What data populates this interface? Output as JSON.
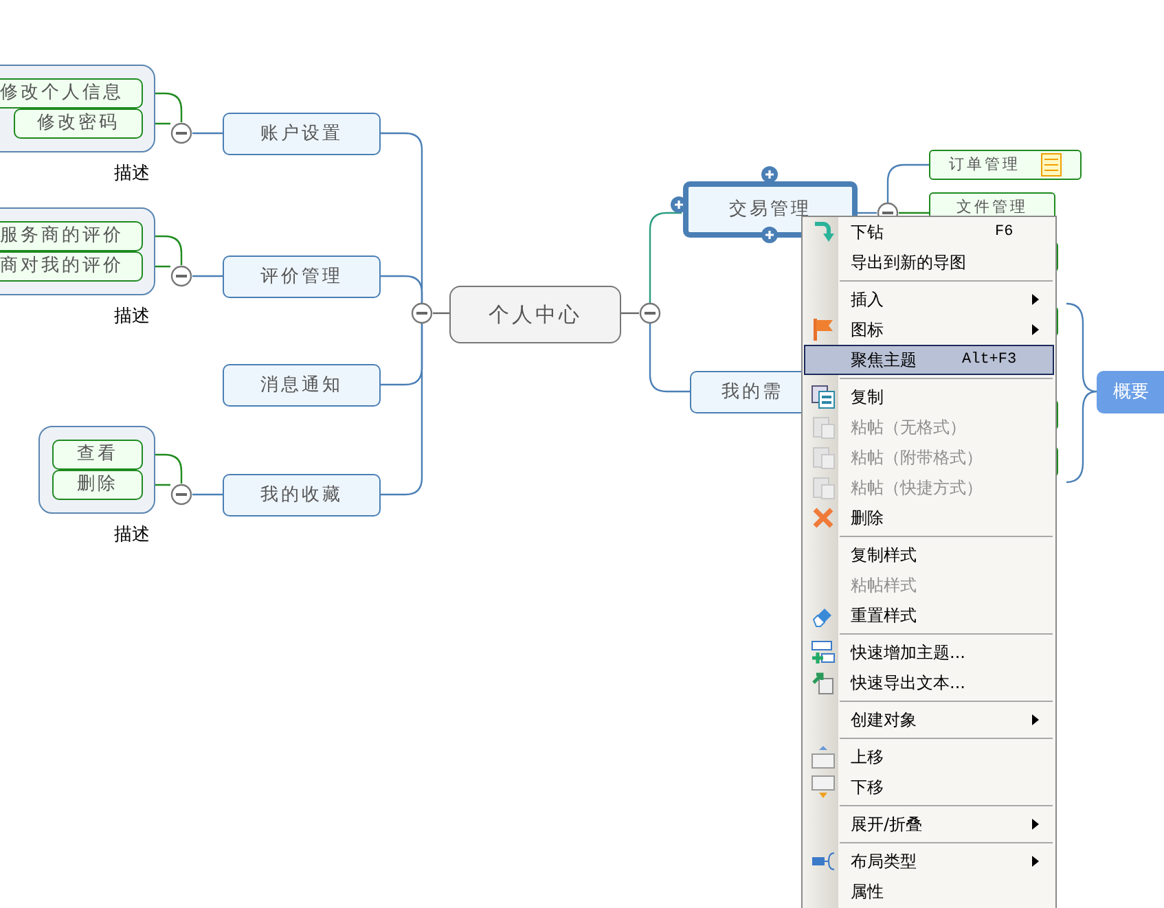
{
  "mindmap": {
    "central": {
      "label": "个人中心"
    },
    "left_topics": [
      {
        "label": "账户设置",
        "boundary": {
          "label": "描述",
          "children": [
            {
              "label": "修改个人信息"
            },
            {
              "label": "修改密码"
            }
          ]
        }
      },
      {
        "label": "评价管理",
        "boundary": {
          "label": "描述",
          "children": [
            {
              "label": "服务商的评价"
            },
            {
              "label": "商对我的评价"
            }
          ]
        }
      },
      {
        "label": "消息通知"
      },
      {
        "label": "我的收藏",
        "boundary": {
          "label": "描述",
          "children": [
            {
              "label": "查看"
            },
            {
              "label": "删除"
            }
          ]
        }
      }
    ],
    "right_topics": [
      {
        "label": "交易管理",
        "selected": true,
        "children": [
          {
            "label": "订单管理",
            "note": true
          },
          {
            "label": "文件管理",
            "note": false
          }
        ]
      },
      {
        "label": "我的需",
        "selected": false
      }
    ],
    "summary": {
      "label": "概要"
    }
  },
  "context_menu": [
    {
      "kind": "item",
      "label": "下钻",
      "shortcut": "F6",
      "disabled": false,
      "submenu": false,
      "selected": false
    },
    {
      "kind": "item",
      "label": "导出到新的导图",
      "disabled": false,
      "submenu": false,
      "selected": false
    },
    {
      "kind": "separator"
    },
    {
      "kind": "item",
      "label": "插入",
      "disabled": false,
      "submenu": true,
      "selected": false
    },
    {
      "kind": "item",
      "label": "图标",
      "disabled": false,
      "submenu": true,
      "selected": false
    },
    {
      "kind": "item",
      "label": "聚焦主题",
      "shortcut": "Alt+F3",
      "disabled": false,
      "submenu": false,
      "selected": true
    },
    {
      "kind": "separator"
    },
    {
      "kind": "item",
      "label": "复制",
      "disabled": false,
      "submenu": false,
      "selected": false
    },
    {
      "kind": "item",
      "label": "粘帖（无格式）",
      "disabled": true,
      "submenu": false,
      "selected": false
    },
    {
      "kind": "item",
      "label": "粘帖（附带格式）",
      "disabled": true,
      "submenu": false,
      "selected": false
    },
    {
      "kind": "item",
      "label": "粘帖（快捷方式）",
      "disabled": true,
      "submenu": false,
      "selected": false
    },
    {
      "kind": "item",
      "label": "删除",
      "disabled": false,
      "submenu": false,
      "selected": false
    },
    {
      "kind": "separator"
    },
    {
      "kind": "item",
      "label": "复制样式",
      "disabled": false,
      "submenu": false,
      "selected": false
    },
    {
      "kind": "item",
      "label": "粘帖样式",
      "disabled": true,
      "submenu": false,
      "selected": false
    },
    {
      "kind": "item",
      "label": "重置样式",
      "disabled": false,
      "submenu": false,
      "selected": false
    },
    {
      "kind": "separator"
    },
    {
      "kind": "item",
      "label": "快速增加主题...",
      "disabled": false,
      "submenu": false,
      "selected": false
    },
    {
      "kind": "item",
      "label": "快速导出文本...",
      "disabled": false,
      "submenu": false,
      "selected": false
    },
    {
      "kind": "separator"
    },
    {
      "kind": "item",
      "label": "创建对象",
      "disabled": false,
      "submenu": true,
      "selected": false
    },
    {
      "kind": "separator"
    },
    {
      "kind": "item",
      "label": "上移",
      "disabled": false,
      "submenu": false,
      "selected": false
    },
    {
      "kind": "item",
      "label": "下移",
      "disabled": false,
      "submenu": false,
      "selected": false
    },
    {
      "kind": "separator"
    },
    {
      "kind": "item",
      "label": "展开/折叠",
      "disabled": false,
      "submenu": true,
      "selected": false
    },
    {
      "kind": "separator"
    },
    {
      "kind": "item",
      "label": "布局类型",
      "disabled": false,
      "submenu": true,
      "selected": false
    },
    {
      "kind": "item",
      "label": "属性",
      "disabled": false,
      "submenu": false,
      "selected": false
    }
  ]
}
